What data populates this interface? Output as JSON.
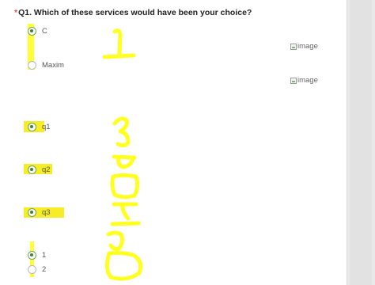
{
  "question": {
    "required_mark": "*",
    "text": "Q1. Which of these services would have been your choice?"
  },
  "options": [
    {
      "label": "C",
      "checked": true
    },
    {
      "label": "Maxim",
      "checked": false
    },
    {
      "label": "q1",
      "checked": true
    },
    {
      "label": "q2",
      "checked": true
    },
    {
      "label": "q3",
      "checked": true
    },
    {
      "label": "1",
      "checked": true
    },
    {
      "label": "2",
      "checked": false
    }
  ],
  "images": [
    {
      "alt": "image"
    },
    {
      "alt": "image"
    }
  ],
  "colors": {
    "highlight": "#ffff33",
    "radio_accent": "#6aa84f",
    "required": "#d9534f"
  }
}
